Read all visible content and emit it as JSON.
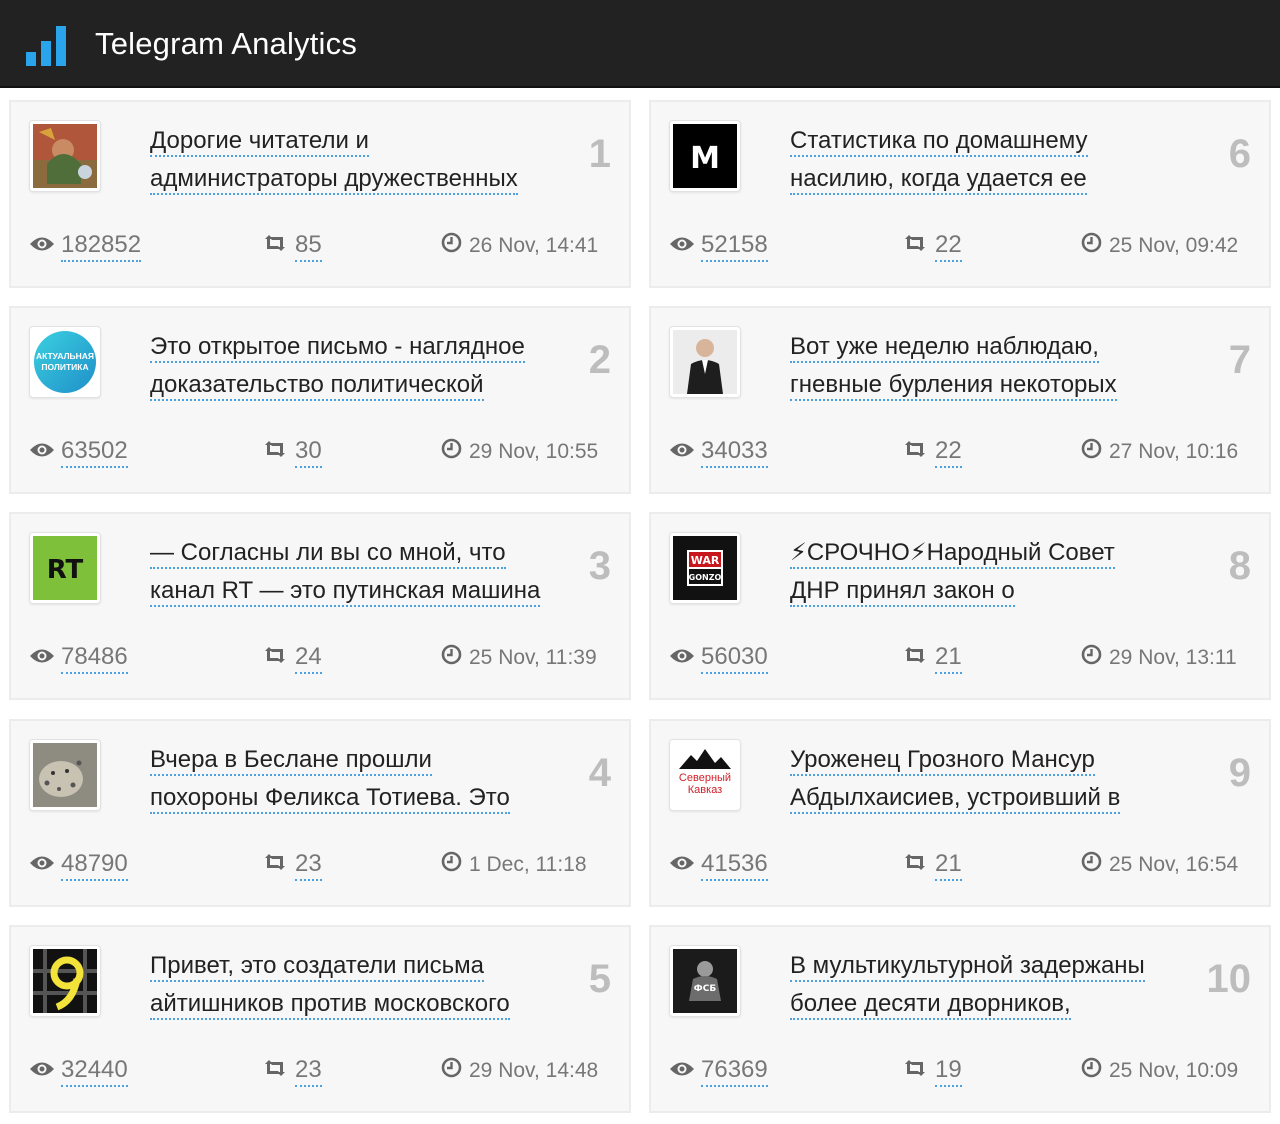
{
  "header": {
    "title": "Telegram Analytics"
  },
  "colors": {
    "topbar": "#222222",
    "accent": "#4aa3df",
    "rank": "#bdbdbd"
  },
  "posts": [
    {
      "rank": "1",
      "line1": "Дорогие читатели и",
      "line2": "администраторы дружественных",
      "views": "182852",
      "shares": "85",
      "time": "26 Nov, 14:41",
      "avatar_icon": "painting-avatar-icon"
    },
    {
      "rank": "2",
      "line1": "Это открытое письмо - наглядное",
      "line2": "доказательство политической",
      "views": "63502",
      "shares": "30",
      "time": "29 Nov, 10:55",
      "avatar_icon": "aktualnaya-politika-logo-icon",
      "avatar_text1": "АКТУАЛЬНАЯ",
      "avatar_text2": "ПОЛИТИКА"
    },
    {
      "rank": "3",
      "line1": "— Согласны ли вы со мной, что",
      "line2": "канал RT — это путинская машина",
      "views": "78486",
      "shares": "24",
      "time": "25 Nov, 11:39",
      "avatar_icon": "rt-logo-icon",
      "avatar_text1": "RT"
    },
    {
      "rank": "4",
      "line1": "Вчера в Беслане прошли",
      "line2": "похороны Феликса Тотиева. Это",
      "views": "48790",
      "shares": "23",
      "time": "1 Dec, 11:18",
      "avatar_icon": "snow-leopard-avatar-icon"
    },
    {
      "rank": "5",
      "line1": "Привет, это создатели письма",
      "line2": "айтишников против московского",
      "views": "32440",
      "shares": "23",
      "time": "29 Nov, 14:48",
      "avatar_icon": "yellow-symbol-avatar-icon"
    },
    {
      "rank": "6",
      "line1": "Статистика по домашнему",
      "line2": "насилию, когда удается ее",
      "views": "52158",
      "shares": "22",
      "time": "25 Nov, 09:42",
      "avatar_icon": "m-logo-icon",
      "avatar_text1": "M"
    },
    {
      "rank": "7",
      "line1": "Вот уже неделю наблюдаю,",
      "line2": "гневные бурления некоторых",
      "views": "34033",
      "shares": "22",
      "time": "27 Nov, 10:16",
      "avatar_icon": "person-photo-avatar-icon"
    },
    {
      "rank": "8",
      "line1": "⚡СРОЧНО⚡Народный Совет",
      "line2": "ДНР принял закон о",
      "views": "56030",
      "shares": "21",
      "time": "29 Nov, 13:11",
      "avatar_icon": "war-gonzo-logo-icon",
      "avatar_text1": "WAR",
      "avatar_text2": "GONZO"
    },
    {
      "rank": "9",
      "line1": "Уроженец Грозного Мансур",
      "line2": "Абдылхаисиев, устроивший в",
      "views": "41536",
      "shares": "21",
      "time": "25 Nov, 16:54",
      "avatar_icon": "severny-kavkaz-logo-icon",
      "avatar_text1": "Северный",
      "avatar_text2": "Кавказ"
    },
    {
      "rank": "10",
      "line1": "В мультикультурной задержаны",
      "line2": "более десяти дворников,",
      "views": "76369",
      "shares": "19",
      "time": "25 Nov, 10:09",
      "avatar_icon": "fsb-photo-avatar-icon",
      "avatar_text1": "ФСБ"
    }
  ]
}
